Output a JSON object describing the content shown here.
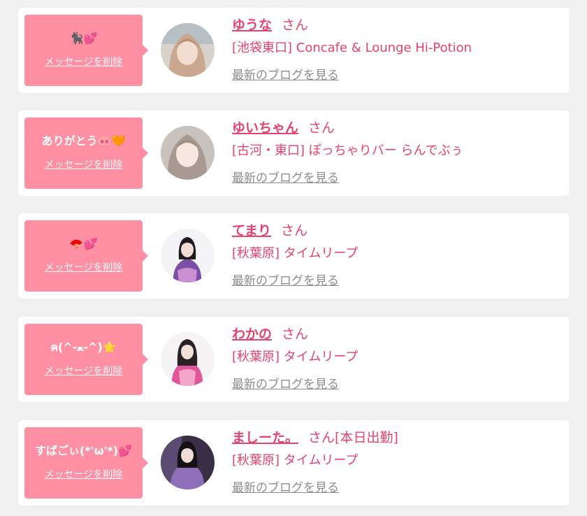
{
  "common": {
    "delete_label": "メッセージを削除",
    "honorific": "さん",
    "blog_link": "最新のブログを見る"
  },
  "colors": {
    "bubble": "#ff8fa3",
    "accent": "#e8426e",
    "link_gray": "#8c8c8c",
    "background": "#f1f0f0"
  },
  "messages": [
    {
      "message": "🐈‍⬛💕",
      "name": "ゆうな",
      "status": "",
      "shop": "[池袋東口] Concafe & Lounge Hi-Potion",
      "avatar": "avatar-photo"
    },
    {
      "message": "ありがとう🐽🧡",
      "name": "ゆいちゃん",
      "status": "",
      "shop": "[古河・東口] ぽっちゃりバー らんでぶぅ",
      "avatar": "avatar-photo"
    },
    {
      "message": "🪭💕",
      "name": "てまり",
      "status": "",
      "shop": "[秋葉原] タイムリープ",
      "avatar": "avatar-photo"
    },
    {
      "message": "ฅ(^-ﻌ-^)⭐",
      "name": "わかの",
      "status": "",
      "shop": "[秋葉原] タイムリープ",
      "avatar": "avatar-photo"
    },
    {
      "message": "すばごぃ(*'ω'*)💕",
      "name": "ましーた。",
      "status": "[本日出勤]",
      "shop": "[秋葉原] タイムリープ",
      "avatar": "avatar-photo"
    }
  ]
}
